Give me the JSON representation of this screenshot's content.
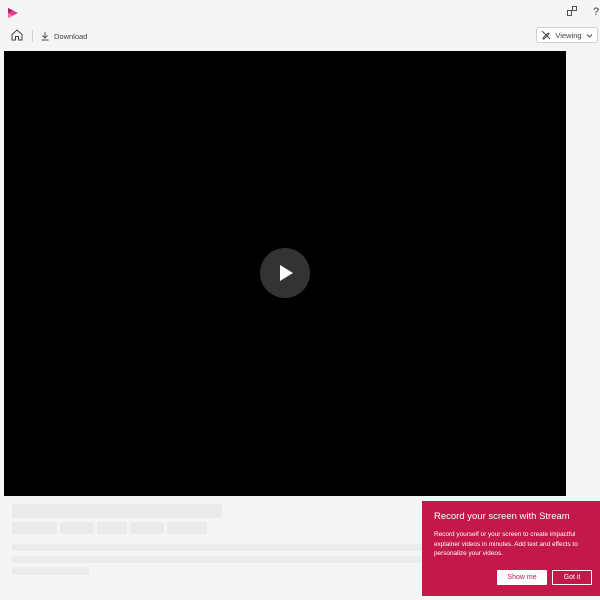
{
  "header": {
    "icons": [
      "stream-logo-icon",
      "share-icon",
      "help-icon"
    ],
    "help_glyph": "?"
  },
  "toolbar": {
    "download_label": "Download",
    "viewing_label": "Viewing"
  },
  "player": {
    "play_icon": "play-icon"
  },
  "promo": {
    "title": "Record your screen with Stream",
    "body": "Record yourself or your screen to create impactful explainer videos in minutes. Add text and effects to personalize your videos.",
    "show_me_label": "Show me",
    "got_it_label": "Got it"
  },
  "colors": {
    "promo_bg": "#c4184a",
    "page_bg": "#f5f5f5",
    "player_bg": "#000000"
  }
}
